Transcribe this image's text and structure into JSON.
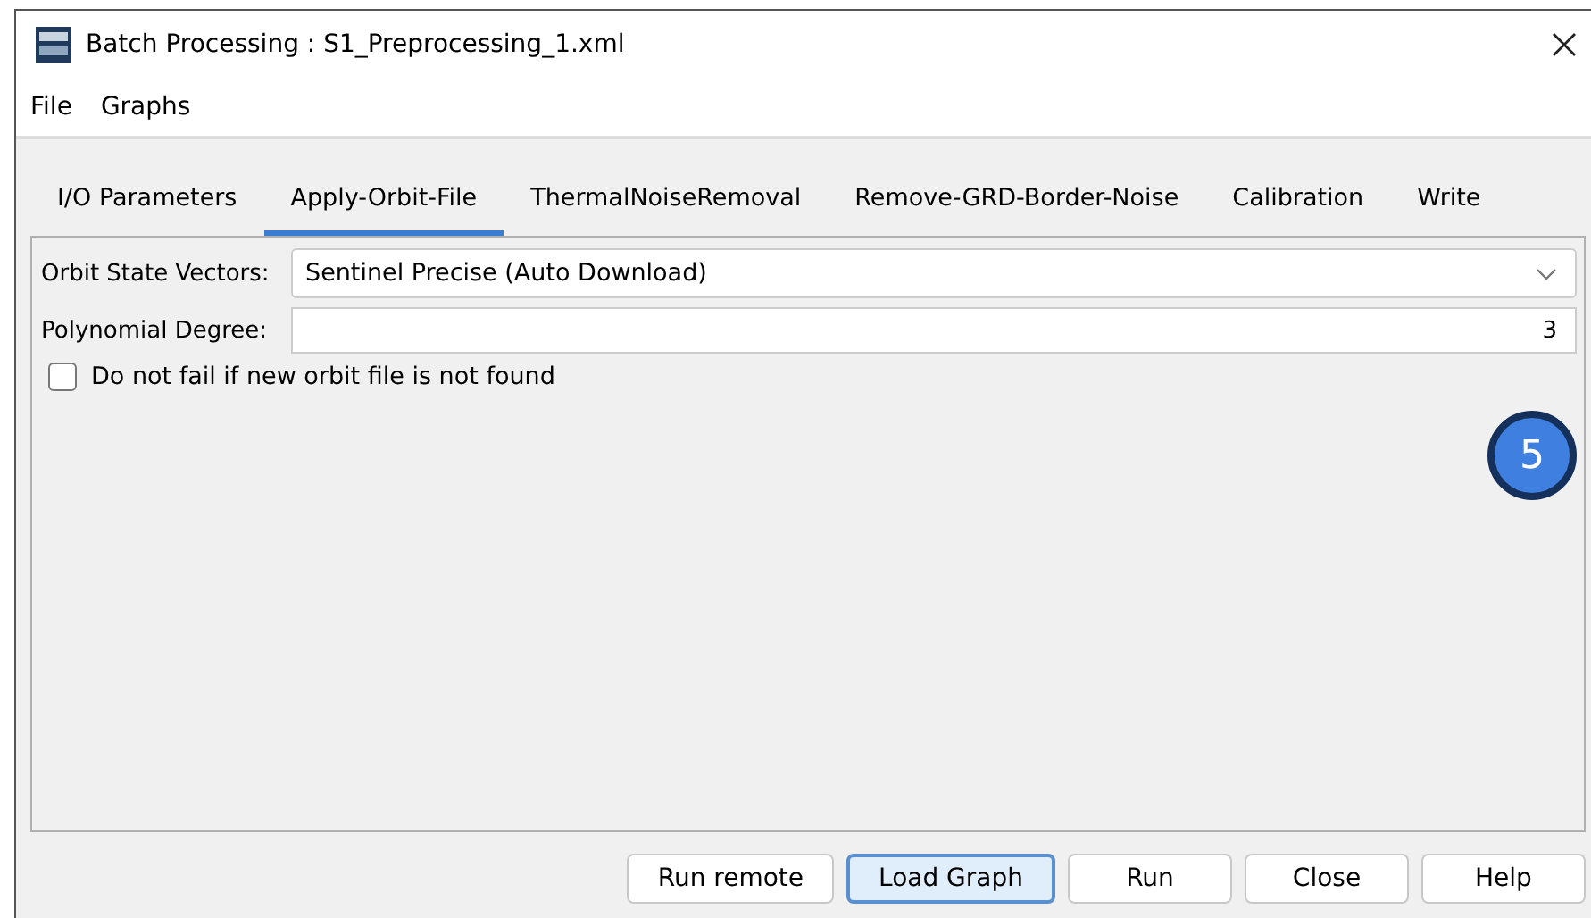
{
  "window": {
    "title": "Batch Processing : S1_Preprocessing_1.xml"
  },
  "menu": [
    "File",
    "Graphs"
  ],
  "tabs": [
    {
      "label": "I/O Parameters",
      "selected": false
    },
    {
      "label": "Apply-Orbit-File",
      "selected": true
    },
    {
      "label": "ThermalNoiseRemoval",
      "selected": false
    },
    {
      "label": "Remove-GRD-Border-Noise",
      "selected": false
    },
    {
      "label": "Calibration",
      "selected": false
    },
    {
      "label": "Write",
      "selected": false
    }
  ],
  "form": [
    {
      "kind": "dropdown",
      "label": "Orbit State Vectors:",
      "value": "Sentinel Precise (Auto Download)"
    },
    {
      "kind": "number",
      "label": "Polynomial Degree:",
      "value": "3"
    },
    {
      "kind": "checkbox",
      "label": "Do not fail if new orbit file is not found",
      "checked": false
    }
  ],
  "step_badge": "5",
  "buttons": [
    {
      "label": "Run remote",
      "focused": false
    },
    {
      "label": "Load Graph",
      "focused": true
    },
    {
      "label": "Run",
      "focused": false
    },
    {
      "label": "Close",
      "focused": false
    },
    {
      "label": "Help",
      "focused": false
    }
  ]
}
